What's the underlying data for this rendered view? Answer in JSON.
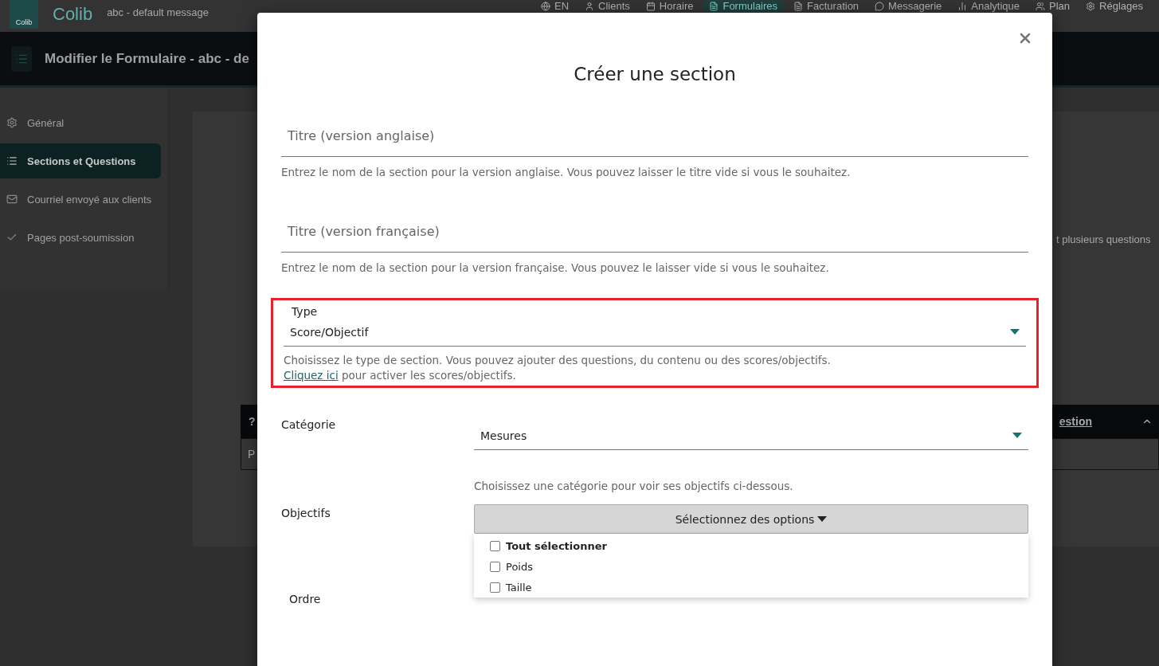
{
  "header": {
    "logo_text": "Colib",
    "brand": "Colib",
    "message": "abc - default message",
    "nav": [
      {
        "label": "EN",
        "selected": false
      },
      {
        "label": "Clients",
        "selected": false
      },
      {
        "label": "Horaire",
        "selected": false
      },
      {
        "label": "Formulaires",
        "selected": true
      },
      {
        "label": "Facturation",
        "selected": false
      },
      {
        "label": "Messagerie",
        "selected": false
      },
      {
        "label": "Analytique",
        "selected": false
      },
      {
        "label": "Plan",
        "selected": false
      },
      {
        "label": "Réglages",
        "selected": false
      }
    ]
  },
  "page_title": "Modifier le Formulaire - abc - de",
  "sidebar": {
    "items": [
      {
        "label": "Général",
        "selected": false
      },
      {
        "label": "Sections et Questions",
        "selected": true
      },
      {
        "label": "Courriel envoyé aux clients",
        "selected": false
      },
      {
        "label": "Pages post-soumission",
        "selected": false
      }
    ]
  },
  "content": {
    "intro_text": "t plusieurs questions",
    "table": {
      "columns": [
        "?",
        "estion"
      ],
      "rows": [
        [
          "P"
        ]
      ]
    }
  },
  "modal": {
    "title": "Créer une section",
    "title_en": {
      "label": "Titre (version anglaise)",
      "help": "Entrez le nom de la section pour la version anglaise. Vous pouvez laisser le titre vide si vous le souhaitez."
    },
    "title_fr": {
      "label": "Titre (version française)",
      "help": "Entrez le nom de la section pour la version française. Vous pouvez le laisser vide si vous le souhaitez."
    },
    "type": {
      "label": "Type",
      "value": "Score/Objectif",
      "highlighted": true,
      "help": "Choisissez le type de section. Vous pouvez ajouter des questions, du contenu ou des scores/objectifs.",
      "link": "Cliquez ici",
      "help_after": " pour activer les scores/objectifs."
    },
    "category": {
      "label": "Catégorie",
      "value": "Mesures",
      "help": "Choisissez une catégorie pour voir ses objectifs ci-dessous."
    },
    "objectives": {
      "label": "Objectifs",
      "button": "Sélectionnez des options",
      "options": [
        {
          "label": "Tout sélectionner",
          "kind": "select_all",
          "checked": false
        },
        {
          "label": "Poids",
          "kind": "option",
          "checked": false
        },
        {
          "label": "Taille",
          "kind": "option",
          "checked": false
        }
      ]
    },
    "order": {
      "label": "Ordre"
    }
  }
}
